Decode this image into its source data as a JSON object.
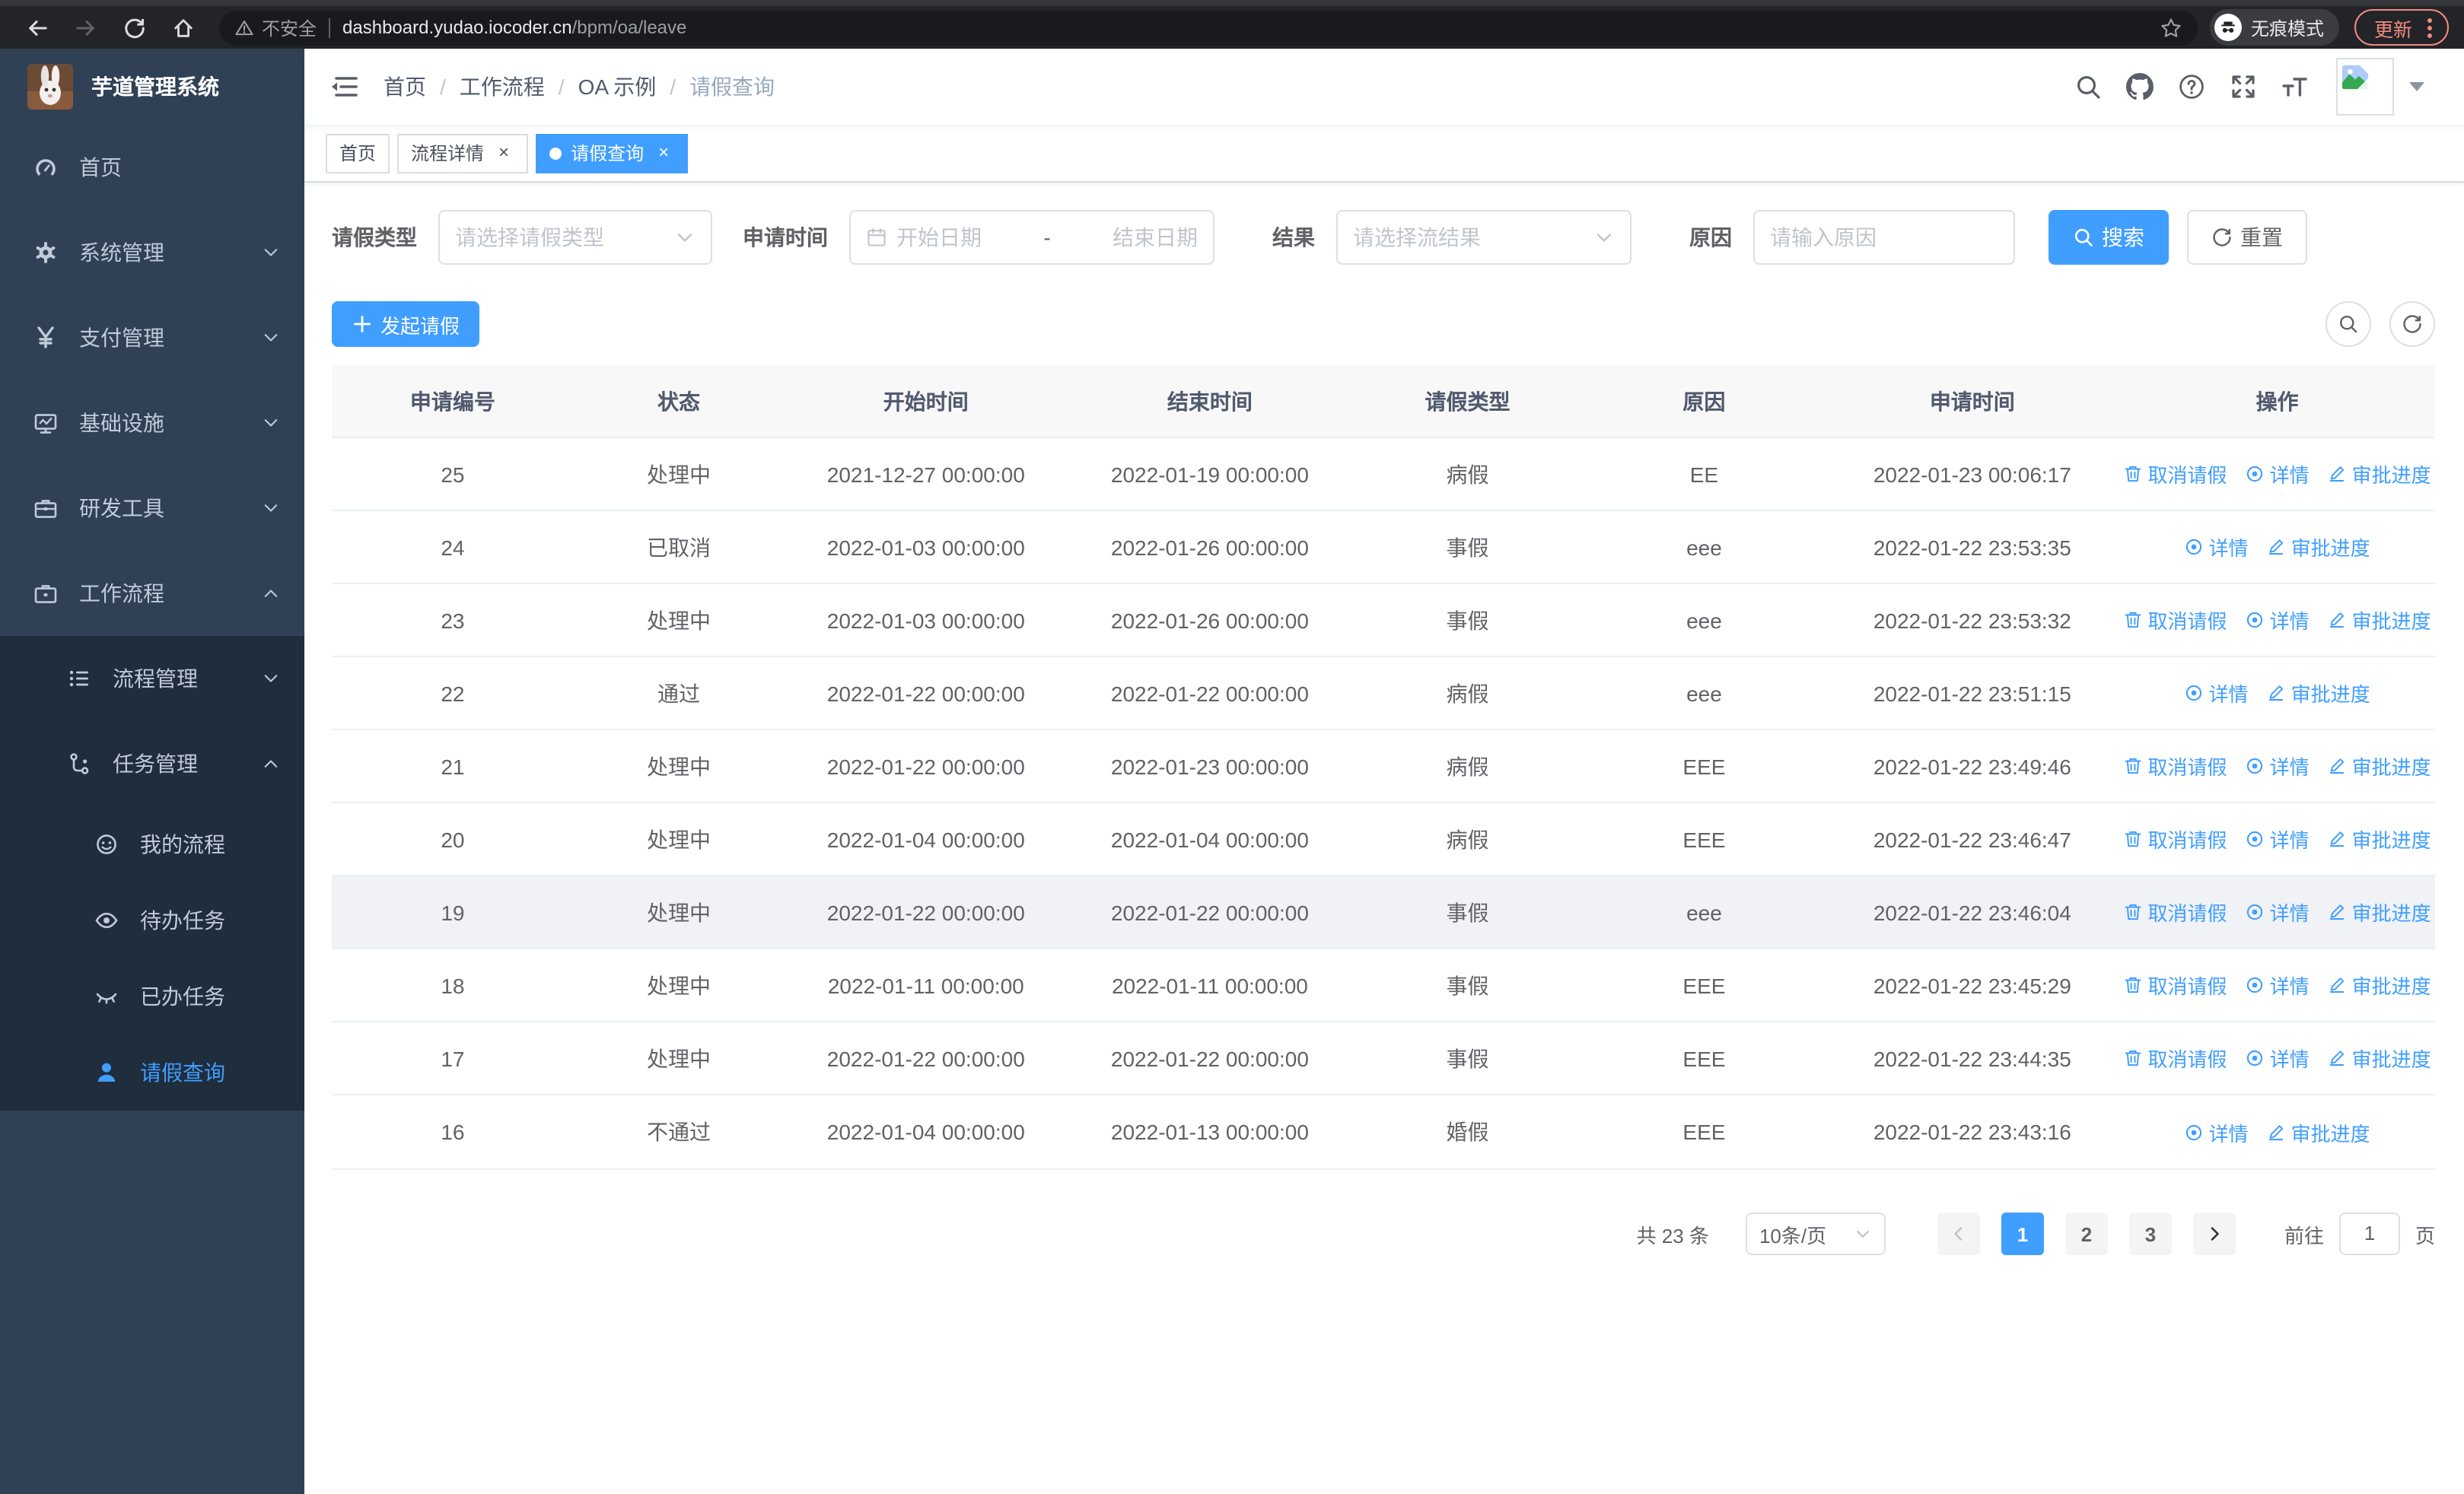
{
  "browser": {
    "security_label": "不安全",
    "url_domain": "dashboard.yudao.iocoder.cn",
    "url_path": "/bpm/oa/leave",
    "incognito_label": "无痕模式",
    "update_label": "更新",
    "update_color": "#f28b82"
  },
  "sidebar": {
    "title": "芋道管理系统",
    "items": [
      {
        "key": "home",
        "label": "首页",
        "icon": "dashboard-icon",
        "level": 1,
        "arrow": null,
        "dark": false,
        "active": false
      },
      {
        "key": "system",
        "label": "系统管理",
        "icon": "gear-icon",
        "level": 1,
        "arrow": "down",
        "dark": false,
        "active": false
      },
      {
        "key": "payment",
        "label": "支付管理",
        "icon": "yen-icon",
        "level": 1,
        "arrow": "down",
        "dark": false,
        "active": false
      },
      {
        "key": "infrastructure",
        "label": "基础设施",
        "icon": "monitor-icon",
        "level": 1,
        "arrow": "down",
        "dark": false,
        "active": false
      },
      {
        "key": "dev-tools",
        "label": "研发工具",
        "icon": "toolbox-icon",
        "level": 1,
        "arrow": "down",
        "dark": false,
        "active": false
      },
      {
        "key": "workflow",
        "label": "工作流程",
        "icon": "briefcase-icon",
        "level": 1,
        "arrow": "up",
        "dark": false,
        "active": false
      },
      {
        "key": "process-mgmt",
        "label": "流程管理",
        "icon": "list-icon",
        "level": 2,
        "arrow": "down",
        "dark": true,
        "active": false
      },
      {
        "key": "task-mgmt",
        "label": "任务管理",
        "icon": "flow-icon",
        "level": 2,
        "arrow": "up",
        "dark": true,
        "active": false
      },
      {
        "key": "my-process",
        "label": "我的流程",
        "icon": "face-icon",
        "level": 3,
        "arrow": null,
        "dark": true,
        "active": false
      },
      {
        "key": "todo-tasks",
        "label": "待办任务",
        "icon": "eye-open-icon",
        "level": 3,
        "arrow": null,
        "dark": true,
        "active": false
      },
      {
        "key": "done-tasks",
        "label": "已办任务",
        "icon": "eye-closed-icon",
        "level": 3,
        "arrow": null,
        "dark": true,
        "active": false
      },
      {
        "key": "leave-query",
        "label": "请假查询",
        "icon": "user-icon",
        "level": 3,
        "arrow": null,
        "dark": true,
        "active": true
      }
    ]
  },
  "navbar": {
    "breadcrumb": [
      "首页",
      "工作流程",
      "OA 示例",
      "请假查询"
    ]
  },
  "tabs": [
    {
      "key": "home",
      "label": "首页",
      "closable": false,
      "active": false
    },
    {
      "key": "process-detail",
      "label": "流程详情",
      "closable": true,
      "active": false
    },
    {
      "key": "leave-query",
      "label": "请假查询",
      "closable": true,
      "active": true
    }
  ],
  "filters": {
    "leave_type_label": "请假类型",
    "leave_type_placeholder": "请选择请假类型",
    "apply_time_label": "申请时间",
    "date_start_placeholder": "开始日期",
    "date_separator": "-",
    "date_end_placeholder": "结束日期",
    "result_label": "结果",
    "result_placeholder": "请选择流结果",
    "reason_label": "原因",
    "reason_placeholder": "请输入原因",
    "search_label": "搜索",
    "reset_label": "重置"
  },
  "toolbar": {
    "create_label": "发起请假"
  },
  "table": {
    "headers": [
      "申请编号",
      "状态",
      "开始时间",
      "结束时间",
      "请假类型",
      "原因",
      "申请时间",
      "操作"
    ],
    "action_labels": {
      "cancel": "取消请假",
      "detail": "详情",
      "progress": "审批进度"
    },
    "rows": [
      {
        "id": "25",
        "status": "处理中",
        "start_time": "2021-12-27 00:00:00",
        "end_time": "2022-01-19 00:00:00",
        "leave_type": "病假",
        "reason": "EE",
        "apply_time": "2022-01-23 00:06:17",
        "can_cancel": true,
        "highlighted": false
      },
      {
        "id": "24",
        "status": "已取消",
        "start_time": "2022-01-03 00:00:00",
        "end_time": "2022-01-26 00:00:00",
        "leave_type": "事假",
        "reason": "eee",
        "apply_time": "2022-01-22 23:53:35",
        "can_cancel": false,
        "highlighted": false
      },
      {
        "id": "23",
        "status": "处理中",
        "start_time": "2022-01-03 00:00:00",
        "end_time": "2022-01-26 00:00:00",
        "leave_type": "事假",
        "reason": "eee",
        "apply_time": "2022-01-22 23:53:32",
        "can_cancel": true,
        "highlighted": false
      },
      {
        "id": "22",
        "status": "通过",
        "start_time": "2022-01-22 00:00:00",
        "end_time": "2022-01-22 00:00:00",
        "leave_type": "病假",
        "reason": "eee",
        "apply_time": "2022-01-22 23:51:15",
        "can_cancel": false,
        "highlighted": false
      },
      {
        "id": "21",
        "status": "处理中",
        "start_time": "2022-01-22 00:00:00",
        "end_time": "2022-01-23 00:00:00",
        "leave_type": "病假",
        "reason": "EEE",
        "apply_time": "2022-01-22 23:49:46",
        "can_cancel": true,
        "highlighted": false
      },
      {
        "id": "20",
        "status": "处理中",
        "start_time": "2022-01-04 00:00:00",
        "end_time": "2022-01-04 00:00:00",
        "leave_type": "病假",
        "reason": "EEE",
        "apply_time": "2022-01-22 23:46:47",
        "can_cancel": true,
        "highlighted": false
      },
      {
        "id": "19",
        "status": "处理中",
        "start_time": "2022-01-22 00:00:00",
        "end_time": "2022-01-22 00:00:00",
        "leave_type": "事假",
        "reason": "eee",
        "apply_time": "2022-01-22 23:46:04",
        "can_cancel": true,
        "highlighted": true
      },
      {
        "id": "18",
        "status": "处理中",
        "start_time": "2022-01-11 00:00:00",
        "end_time": "2022-01-11 00:00:00",
        "leave_type": "事假",
        "reason": "EEE",
        "apply_time": "2022-01-22 23:45:29",
        "can_cancel": true,
        "highlighted": false
      },
      {
        "id": "17",
        "status": "处理中",
        "start_time": "2022-01-22 00:00:00",
        "end_time": "2022-01-22 00:00:00",
        "leave_type": "事假",
        "reason": "EEE",
        "apply_time": "2022-01-22 23:44:35",
        "can_cancel": true,
        "highlighted": false
      },
      {
        "id": "16",
        "status": "不通过",
        "start_time": "2022-01-04 00:00:00",
        "end_time": "2022-01-13 00:00:00",
        "leave_type": "婚假",
        "reason": "EEE",
        "apply_time": "2022-01-22 23:43:16",
        "can_cancel": false,
        "highlighted": false
      }
    ]
  },
  "pagination": {
    "total_label": "共 23 条",
    "page_size_label": "10条/页",
    "pages": [
      "1",
      "2",
      "3"
    ],
    "active_page": "1",
    "goto_label": "前往",
    "goto_value": "1",
    "page_suffix": "页"
  },
  "colors": {
    "accent": "#409eff",
    "sidebar_bg": "#304156",
    "submenu_bg": "#1f2d3d",
    "update_button": "#f28b82"
  }
}
